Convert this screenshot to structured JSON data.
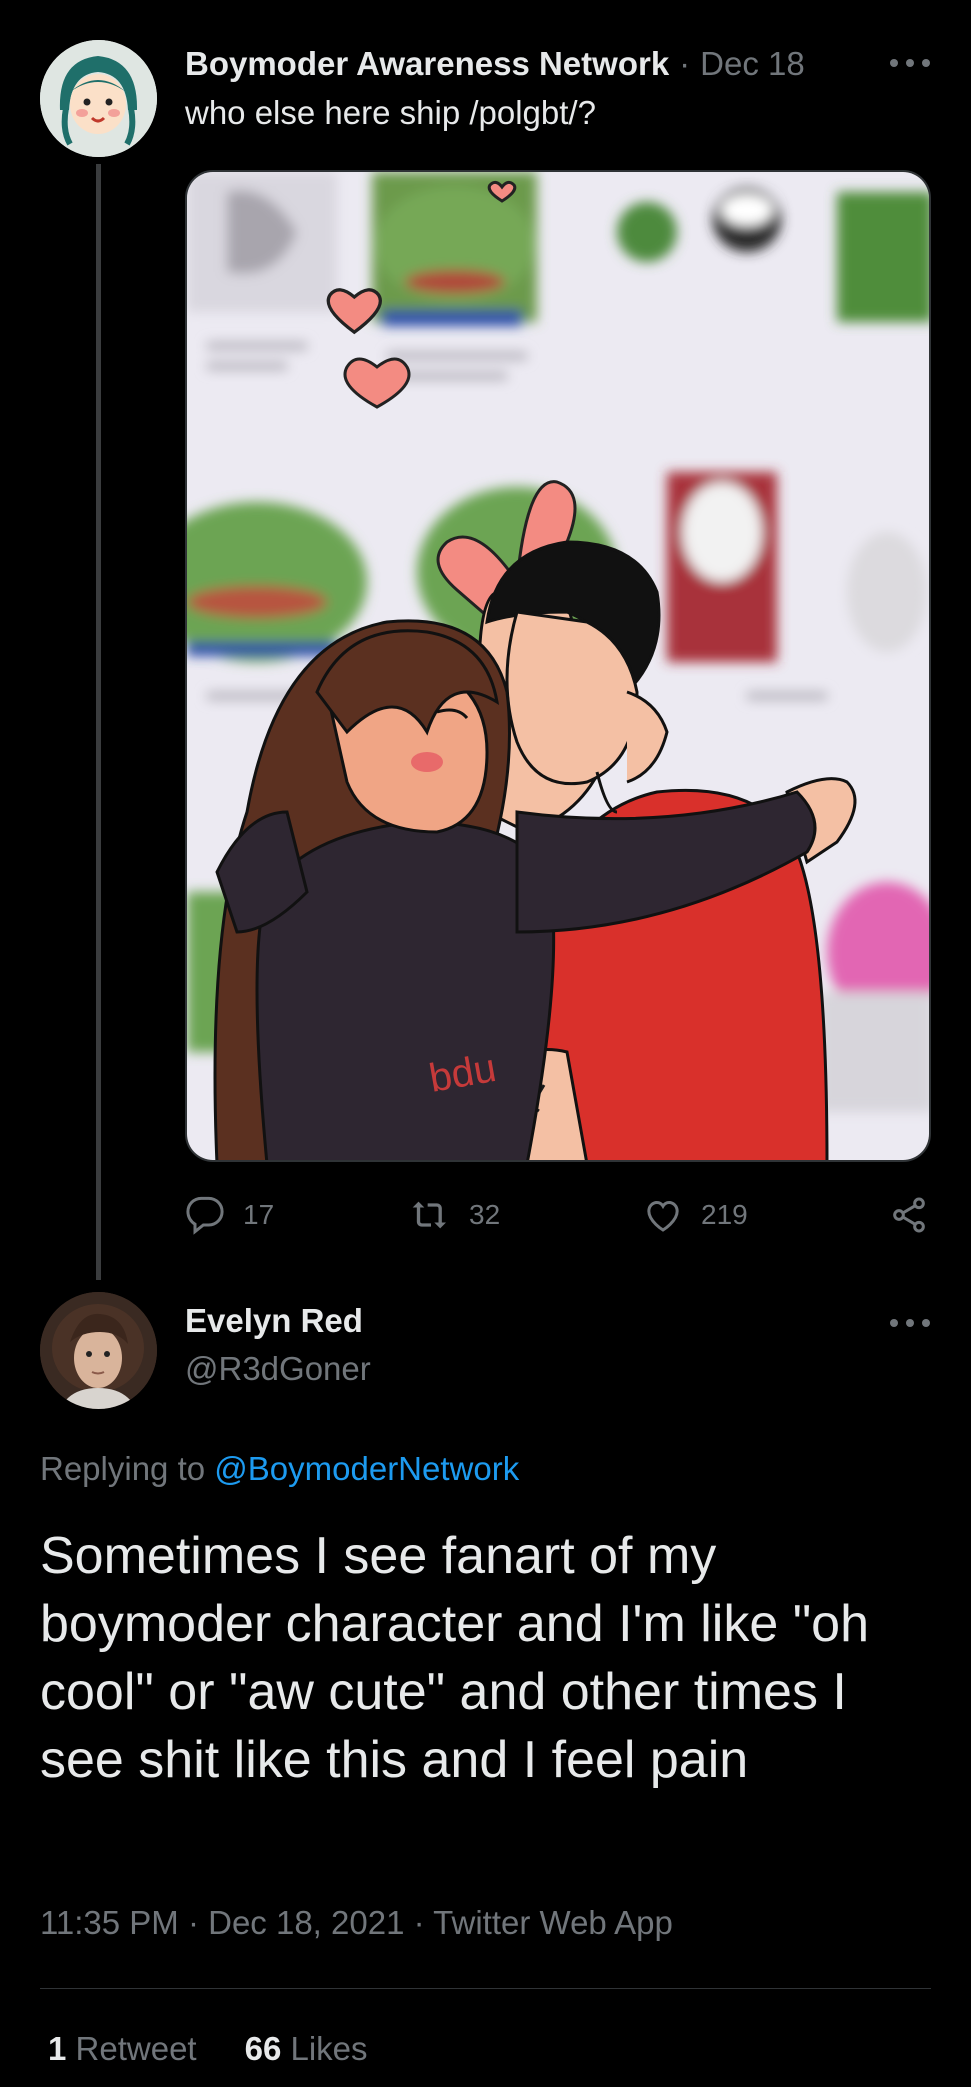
{
  "parent_tweet": {
    "author_name": "Boymoder Awareness Network",
    "separator": "·",
    "date": "Dec 18",
    "text": "who else here ship /polgbt/?",
    "image_text": "bdu",
    "actions": {
      "replies": "17",
      "retweets": "32",
      "likes": "219"
    }
  },
  "main_tweet": {
    "author_name": "Evelyn Red",
    "handle": "@R3dGoner",
    "replying_prefix": "Replying to",
    "replying_to": "@BoymoderNetwork",
    "text": "Sometimes I see fanart of my boymoder character and I'm like \"oh cool\" or \"aw cute\" and other times I see shit like this and I feel pain",
    "timestamp": "11:35 PM · Dec 18, 2021 · Twitter Web App",
    "retweet_count": "1",
    "retweet_label": "Retweet",
    "like_count": "66",
    "like_label": "Likes"
  },
  "colors": {
    "background": "#000000",
    "text": "#e7e9ea",
    "muted": "#71767b",
    "link": "#1d9bf0",
    "divider": "#2f3336"
  },
  "icons": [
    "more-icon",
    "reply-icon",
    "retweet-icon",
    "like-icon",
    "share-icon"
  ]
}
